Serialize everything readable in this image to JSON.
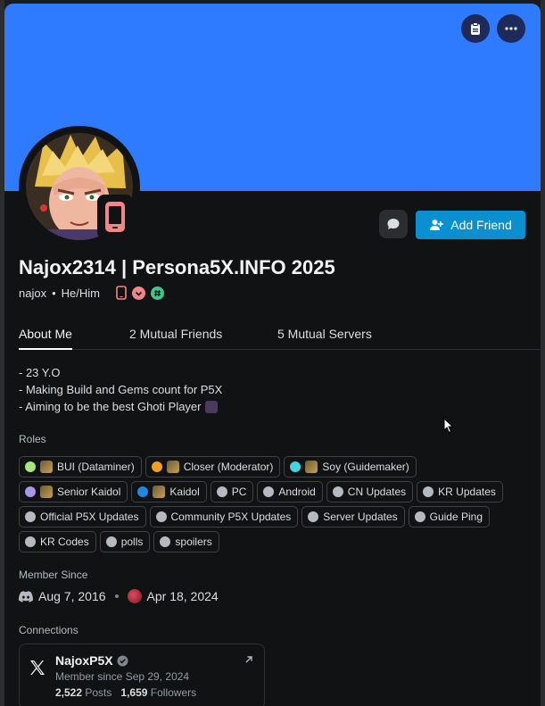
{
  "header": {
    "clipboard_icon": "clipboard-icon",
    "more_icon": "ellipsis-icon"
  },
  "actions": {
    "add_friend_label": "Add Friend"
  },
  "profile": {
    "display_name": "Najox2314 | Persona5X.INFO 2025",
    "username": "najox",
    "pronouns": "He/Him",
    "bullet": "•"
  },
  "tabs": [
    {
      "label": "About Me",
      "active": true
    },
    {
      "label": "2 Mutual Friends",
      "active": false
    },
    {
      "label": "5 Mutual Servers",
      "active": false
    }
  ],
  "bio": {
    "line1": "- 23 Y.O",
    "line2": "- Making Build and Gems count for P5X",
    "line3": "- Aiming to be the best Ghoti Player"
  },
  "roles_label": "Roles",
  "roles": [
    {
      "label": "BUI (Dataminer)",
      "color": "#a6e67a",
      "emoji": true
    },
    {
      "label": "Closer (Moderator)",
      "color": "#f0a020",
      "emoji": true
    },
    {
      "label": "Soy (Guidemaker)",
      "color": "#3fd6e0",
      "emoji": true
    },
    {
      "label": "Senior Kaidol",
      "color": "#a996e8",
      "emoji": true
    },
    {
      "label": "Kaidol",
      "color": "#1e88e5",
      "emoji": true
    },
    {
      "label": "PC",
      "color": "#b5bac1",
      "emoji": false
    },
    {
      "label": "Android",
      "color": "#b5bac1",
      "emoji": false
    },
    {
      "label": "CN Updates",
      "color": "#b5bac1",
      "emoji": false
    },
    {
      "label": "KR Updates",
      "color": "#b5bac1",
      "emoji": false
    },
    {
      "label": "Official P5X Updates",
      "color": "#b5bac1",
      "emoji": false
    },
    {
      "label": "Community P5X Updates",
      "color": "#b5bac1",
      "emoji": false
    },
    {
      "label": "Server Updates",
      "color": "#b5bac1",
      "emoji": false
    },
    {
      "label": "Guide Ping",
      "color": "#b5bac1",
      "emoji": false
    },
    {
      "label": "KR Codes",
      "color": "#b5bac1",
      "emoji": false
    },
    {
      "label": "polls",
      "color": "#b5bac1",
      "emoji": false
    },
    {
      "label": "spoilers",
      "color": "#b5bac1",
      "emoji": false
    }
  ],
  "member_since": {
    "label": "Member Since",
    "discord_date": "Aug 7, 2016",
    "server_date": "Apr 18, 2024"
  },
  "connections": {
    "label": "Connections",
    "name": "NajoxP5X",
    "since": "Member since Sep 29, 2024",
    "posts_count": "2,522",
    "posts_label": "Posts",
    "followers_count": "1,659",
    "followers_label": "Followers"
  },
  "colors": {
    "banner": "#2f7bff",
    "accent_button": "#0a8fd1",
    "mobile_status": "#f0868a"
  }
}
